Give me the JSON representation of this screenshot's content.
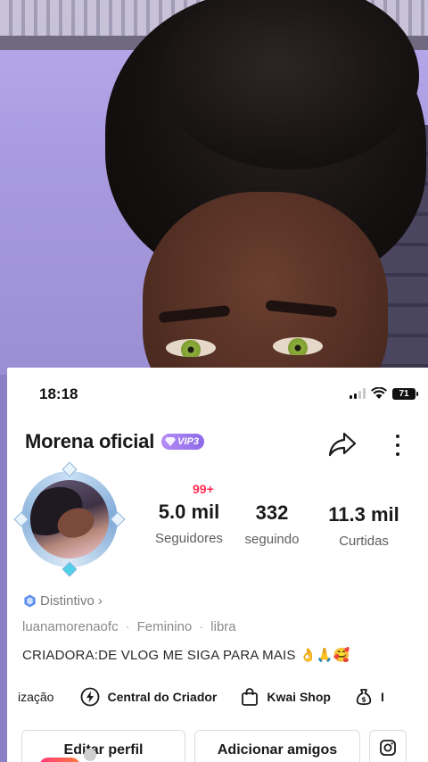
{
  "status": {
    "time": "18:18",
    "battery": "71"
  },
  "profile": {
    "name": "Morena oficial",
    "vip_label": "VIP3",
    "notif_badge": "99+",
    "distintivo": "Distintivo",
    "distintivo_chevron": "›",
    "username": "luanamorenaofc",
    "gender": "Feminino",
    "sign": "libra",
    "bio": "CRIADORA:DE VLOG ME SIGA PARA MAIS 👌🙏🥰"
  },
  "stats": [
    {
      "value": "5.0 mil",
      "label": "Seguidores"
    },
    {
      "value": "332",
      "label": "seguindo"
    },
    {
      "value": "11.3 mil",
      "label": "Curtidas"
    }
  ],
  "tools": [
    {
      "label": "ização"
    },
    {
      "label": "Central do Criador",
      "icon": "lightning-icon"
    },
    {
      "label": "Kwai Shop",
      "icon": "shopping-bag-icon"
    },
    {
      "label": "I",
      "icon": "money-bag-icon"
    }
  ],
  "buttons": {
    "edit": "Editar perfil",
    "add": "Adicionar amigos"
  },
  "colors": {
    "vip": "#9b74ec",
    "badge": "#ff2d55",
    "accent_pink": "#ff3a7a"
  }
}
